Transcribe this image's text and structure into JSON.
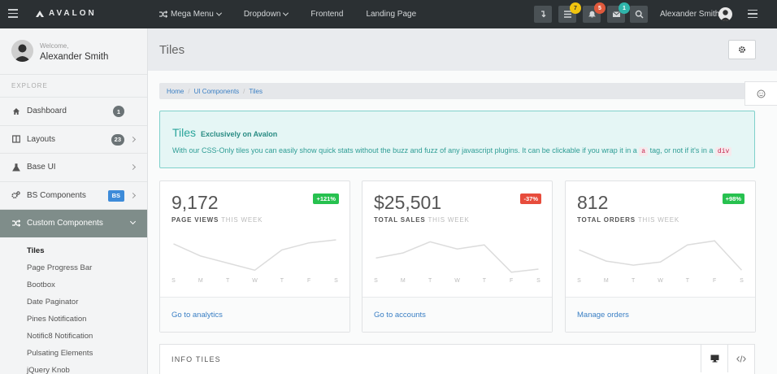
{
  "topbar": {
    "brand": "AVALON",
    "nav": [
      {
        "label": "Mega Menu",
        "has_caret": true,
        "icon": "shuffle-icon"
      },
      {
        "label": "Dropdown",
        "has_caret": true
      },
      {
        "label": "Frontend"
      },
      {
        "label": "Landing Page"
      }
    ],
    "badges": {
      "messages": "7",
      "notifications": "5",
      "mail": "1"
    },
    "user_name": "Alexander Smith"
  },
  "sidebar": {
    "welcome": "Welcome,",
    "name": "Alexander Smith",
    "section": "EXPLORE",
    "items": [
      {
        "label": "Dashboard",
        "icon": "home-icon",
        "count": "1"
      },
      {
        "label": "Layouts",
        "icon": "columns-icon",
        "count": "23"
      },
      {
        "label": "Base UI",
        "icon": "flask-icon"
      },
      {
        "label": "BS Components",
        "icon": "cogs-icon",
        "badge": "BS"
      },
      {
        "label": "Custom Components",
        "icon": "shuffle-icon",
        "active": true
      }
    ],
    "sub_items": [
      "Tiles",
      "Page Progress Bar",
      "Bootbox",
      "Date Paginator",
      "Pines Notification",
      "Notific8 Notification",
      "Pulsating Elements",
      "jQuery Knob"
    ]
  },
  "page": {
    "title": "Tiles",
    "breadcrumb": [
      "Home",
      "UI Components",
      "Tiles"
    ]
  },
  "callout": {
    "title": "Tiles",
    "subtitle": "Exclusively on Avalon",
    "body_1": "With our CSS-Only tiles you can easily show quick stats without the buzz and fuzz of any javascript plugins. It can be clickable if you wrap it in a",
    "code_1": "a",
    "body_2": "tag, or not if it's in a",
    "code_2": "div"
  },
  "tiles": [
    {
      "value": "9,172",
      "label": "PAGE VIEWS",
      "period": "THIS WEEK",
      "badge": "+121%",
      "badge_color": "#27c14f",
      "link": "Go to analytics",
      "spark": [
        12,
        24,
        31,
        38,
        18,
        11,
        8
      ]
    },
    {
      "value": "$25,501",
      "label": "TOTAL SALES",
      "period": "THIS WEEK",
      "badge": "-37%",
      "badge_color": "#e74c3c",
      "link": "Go to accounts",
      "spark": [
        26,
        21,
        10,
        17,
        13,
        40,
        37
      ]
    },
    {
      "value": "812",
      "label": "TOTAL ORDERS",
      "period": "THIS WEEK",
      "badge": "+98%",
      "badge_color": "#27c14f",
      "link": "Manage orders",
      "spark": [
        18,
        29,
        33,
        30,
        13,
        9,
        38
      ]
    }
  ],
  "days": [
    "S",
    "M",
    "T",
    "W",
    "T",
    "F",
    "S"
  ],
  "info_tiles": {
    "title": "INFO TILES"
  },
  "colors": {
    "topbar": "#2b3033",
    "accent": "#3a7fc4",
    "teal": "#2aa59b",
    "active_sidebar": "#7f8d8a"
  }
}
